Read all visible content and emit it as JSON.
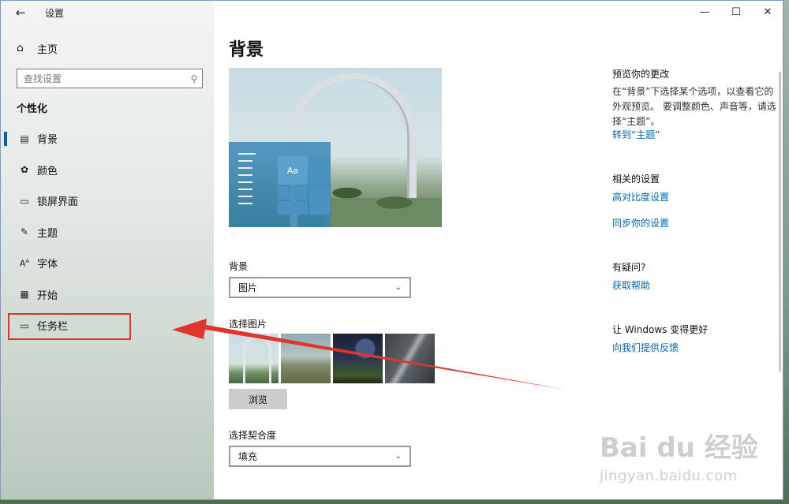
{
  "window": {
    "app_title": "设置",
    "controls": {
      "minimize": "—",
      "maximize": "☐",
      "close": "✕"
    }
  },
  "sidebar": {
    "back_icon": "back-arrow-icon",
    "home_label": "主页",
    "search_placeholder": "查找设置",
    "section_title": "个性化",
    "items": [
      {
        "label": "背景",
        "icon": "picture-icon",
        "active": true
      },
      {
        "label": "颜色",
        "icon": "palette-icon"
      },
      {
        "label": "锁屏界面",
        "icon": "lock-screen-icon"
      },
      {
        "label": "主题",
        "icon": "theme-brush-icon"
      },
      {
        "label": "字体",
        "icon": "font-icon"
      },
      {
        "label": "开始",
        "icon": "start-grid-icon"
      },
      {
        "label": "任务栏",
        "icon": "taskbar-icon"
      }
    ]
  },
  "main": {
    "page_title": "背景",
    "preview": {
      "tile_label": "Aa"
    },
    "background_label": "背景",
    "background_value": "图片",
    "choose_picture_label": "选择图片",
    "browse_label": "浏览",
    "fit_label": "选择契合度",
    "fit_value": "填充"
  },
  "side": {
    "preview_title": "预览你的更改",
    "preview_text": "在“背景”下选择某个选项，以查看它的外观预览。 要调整颜色、声音等，请选择“主题”。",
    "goto_theme": "转到“主题”",
    "related_title": "相关的设置",
    "high_contrast": "高对比度设置",
    "sync": "同步你的设置",
    "question_title": "有疑问?",
    "get_help": "获取帮助",
    "improve_title": "让 Windows 变得更好",
    "feedback": "向我们提供反馈"
  },
  "watermark": {
    "brand": "Bai du 经验",
    "url": "jingyan.baidu.com"
  },
  "colors": {
    "accent": "#0063b1",
    "link": "#0067b8",
    "annotation": "#e0352b"
  }
}
